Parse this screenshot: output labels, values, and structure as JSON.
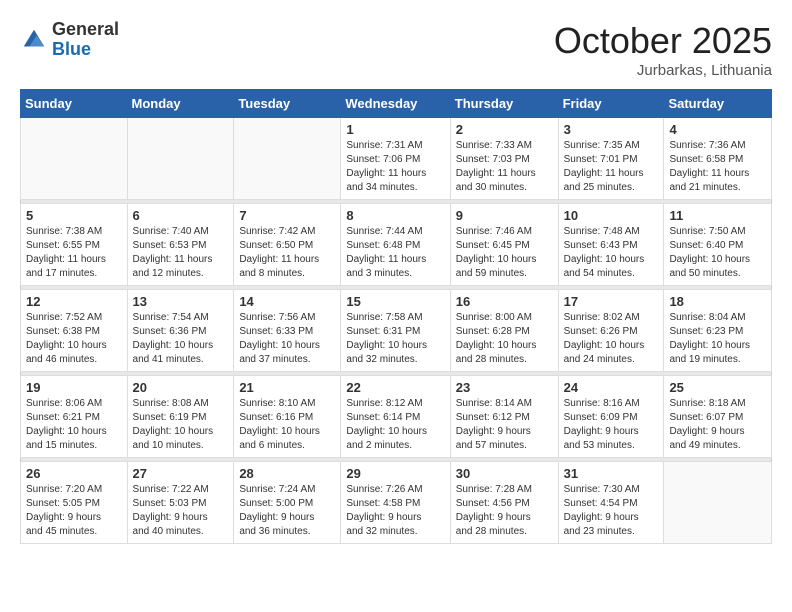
{
  "header": {
    "logo_general": "General",
    "logo_blue": "Blue",
    "month_title": "October 2025",
    "location": "Jurbarkas, Lithuania"
  },
  "weekdays": [
    "Sunday",
    "Monday",
    "Tuesday",
    "Wednesday",
    "Thursday",
    "Friday",
    "Saturday"
  ],
  "weeks": [
    [
      {
        "num": "",
        "info": ""
      },
      {
        "num": "",
        "info": ""
      },
      {
        "num": "",
        "info": ""
      },
      {
        "num": "1",
        "info": "Sunrise: 7:31 AM\nSunset: 7:06 PM\nDaylight: 11 hours\nand 34 minutes."
      },
      {
        "num": "2",
        "info": "Sunrise: 7:33 AM\nSunset: 7:03 PM\nDaylight: 11 hours\nand 30 minutes."
      },
      {
        "num": "3",
        "info": "Sunrise: 7:35 AM\nSunset: 7:01 PM\nDaylight: 11 hours\nand 25 minutes."
      },
      {
        "num": "4",
        "info": "Sunrise: 7:36 AM\nSunset: 6:58 PM\nDaylight: 11 hours\nand 21 minutes."
      }
    ],
    [
      {
        "num": "5",
        "info": "Sunrise: 7:38 AM\nSunset: 6:55 PM\nDaylight: 11 hours\nand 17 minutes."
      },
      {
        "num": "6",
        "info": "Sunrise: 7:40 AM\nSunset: 6:53 PM\nDaylight: 11 hours\nand 12 minutes."
      },
      {
        "num": "7",
        "info": "Sunrise: 7:42 AM\nSunset: 6:50 PM\nDaylight: 11 hours\nand 8 minutes."
      },
      {
        "num": "8",
        "info": "Sunrise: 7:44 AM\nSunset: 6:48 PM\nDaylight: 11 hours\nand 3 minutes."
      },
      {
        "num": "9",
        "info": "Sunrise: 7:46 AM\nSunset: 6:45 PM\nDaylight: 10 hours\nand 59 minutes."
      },
      {
        "num": "10",
        "info": "Sunrise: 7:48 AM\nSunset: 6:43 PM\nDaylight: 10 hours\nand 54 minutes."
      },
      {
        "num": "11",
        "info": "Sunrise: 7:50 AM\nSunset: 6:40 PM\nDaylight: 10 hours\nand 50 minutes."
      }
    ],
    [
      {
        "num": "12",
        "info": "Sunrise: 7:52 AM\nSunset: 6:38 PM\nDaylight: 10 hours\nand 46 minutes."
      },
      {
        "num": "13",
        "info": "Sunrise: 7:54 AM\nSunset: 6:36 PM\nDaylight: 10 hours\nand 41 minutes."
      },
      {
        "num": "14",
        "info": "Sunrise: 7:56 AM\nSunset: 6:33 PM\nDaylight: 10 hours\nand 37 minutes."
      },
      {
        "num": "15",
        "info": "Sunrise: 7:58 AM\nSunset: 6:31 PM\nDaylight: 10 hours\nand 32 minutes."
      },
      {
        "num": "16",
        "info": "Sunrise: 8:00 AM\nSunset: 6:28 PM\nDaylight: 10 hours\nand 28 minutes."
      },
      {
        "num": "17",
        "info": "Sunrise: 8:02 AM\nSunset: 6:26 PM\nDaylight: 10 hours\nand 24 minutes."
      },
      {
        "num": "18",
        "info": "Sunrise: 8:04 AM\nSunset: 6:23 PM\nDaylight: 10 hours\nand 19 minutes."
      }
    ],
    [
      {
        "num": "19",
        "info": "Sunrise: 8:06 AM\nSunset: 6:21 PM\nDaylight: 10 hours\nand 15 minutes."
      },
      {
        "num": "20",
        "info": "Sunrise: 8:08 AM\nSunset: 6:19 PM\nDaylight: 10 hours\nand 10 minutes."
      },
      {
        "num": "21",
        "info": "Sunrise: 8:10 AM\nSunset: 6:16 PM\nDaylight: 10 hours\nand 6 minutes."
      },
      {
        "num": "22",
        "info": "Sunrise: 8:12 AM\nSunset: 6:14 PM\nDaylight: 10 hours\nand 2 minutes."
      },
      {
        "num": "23",
        "info": "Sunrise: 8:14 AM\nSunset: 6:12 PM\nDaylight: 9 hours\nand 57 minutes."
      },
      {
        "num": "24",
        "info": "Sunrise: 8:16 AM\nSunset: 6:09 PM\nDaylight: 9 hours\nand 53 minutes."
      },
      {
        "num": "25",
        "info": "Sunrise: 8:18 AM\nSunset: 6:07 PM\nDaylight: 9 hours\nand 49 minutes."
      }
    ],
    [
      {
        "num": "26",
        "info": "Sunrise: 7:20 AM\nSunset: 5:05 PM\nDaylight: 9 hours\nand 45 minutes."
      },
      {
        "num": "27",
        "info": "Sunrise: 7:22 AM\nSunset: 5:03 PM\nDaylight: 9 hours\nand 40 minutes."
      },
      {
        "num": "28",
        "info": "Sunrise: 7:24 AM\nSunset: 5:00 PM\nDaylight: 9 hours\nand 36 minutes."
      },
      {
        "num": "29",
        "info": "Sunrise: 7:26 AM\nSunset: 4:58 PM\nDaylight: 9 hours\nand 32 minutes."
      },
      {
        "num": "30",
        "info": "Sunrise: 7:28 AM\nSunset: 4:56 PM\nDaylight: 9 hours\nand 28 minutes."
      },
      {
        "num": "31",
        "info": "Sunrise: 7:30 AM\nSunset: 4:54 PM\nDaylight: 9 hours\nand 23 minutes."
      },
      {
        "num": "",
        "info": ""
      }
    ]
  ]
}
